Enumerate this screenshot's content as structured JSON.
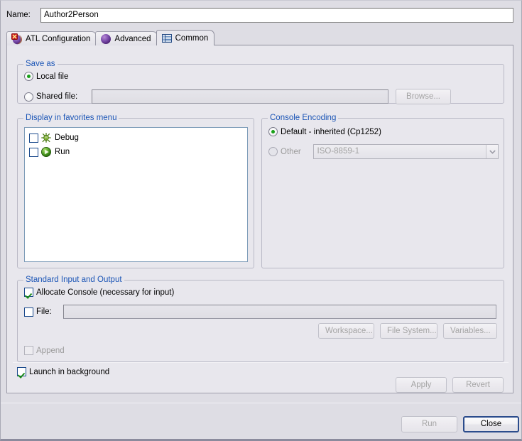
{
  "window": {
    "name_label": "Name:",
    "name_value": "Author2Person"
  },
  "tabs": [
    {
      "label": "ATL Configuration",
      "icon": "atl-config-icon",
      "selected": false
    },
    {
      "label": "Advanced",
      "icon": "advanced-icon",
      "selected": false
    },
    {
      "label": "Common",
      "icon": "common-icon",
      "selected": true
    }
  ],
  "save_as": {
    "title": "Save as",
    "local_file_label": "Local file",
    "local_file_selected": true,
    "shared_file_label": "Shared file:",
    "shared_file_selected": false,
    "shared_file_value": "",
    "browse_label": "Browse...",
    "browse_enabled": false
  },
  "favorites": {
    "title": "Display in favorites menu",
    "items": [
      {
        "label": "Debug",
        "icon": "debug-bug-icon",
        "checked": false
      },
      {
        "label": "Run",
        "icon": "run-play-icon",
        "checked": false
      }
    ]
  },
  "console_encoding": {
    "title": "Console Encoding",
    "default_label": "Default - inherited (Cp1252)",
    "default_selected": true,
    "other_label": "Other",
    "other_selected": false,
    "other_value": "ISO-8859-1",
    "other_enabled": false
  },
  "standard_io": {
    "title": "Standard Input and Output",
    "allocate_console_label": "Allocate Console (necessary for input)",
    "allocate_console_checked": true,
    "file_label": "File:",
    "file_checked": false,
    "file_value": "",
    "workspace_label": "Workspace...",
    "file_system_label": "File System...",
    "variables_label": "Variables...",
    "buttons_enabled": false,
    "append_label": "Append",
    "append_checked": false,
    "append_enabled": false
  },
  "launch_in_background": {
    "label": "Launch in background",
    "checked": true
  },
  "form_buttons": {
    "apply_label": "Apply",
    "apply_enabled": false,
    "revert_label": "Revert",
    "revert_enabled": false
  },
  "dialog_buttons": {
    "run_label": "Run",
    "run_enabled": false,
    "close_label": "Close",
    "close_default": true
  },
  "colors": {
    "background": "#e8e7ed",
    "window_background": "#dedde4",
    "group_title": "#1b55b6",
    "radio_dot": "#18a018",
    "check_mark": "#1a8a1a",
    "default_button_border": "#2b4c8c"
  }
}
